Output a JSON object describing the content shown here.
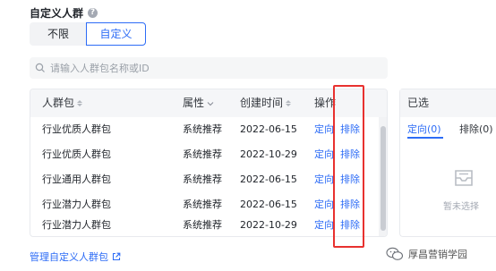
{
  "section": {
    "title": "自定义人群"
  },
  "mode": {
    "options": [
      "不限",
      "自定义"
    ],
    "selected": "自定义"
  },
  "search": {
    "placeholder": "请输入人群包名称或ID"
  },
  "table": {
    "headers": {
      "name": "人群包",
      "attr": "属性",
      "created": "创建时间",
      "actions": "操作"
    },
    "rows": [
      {
        "name": "行业优质人群包",
        "attr": "系统推荐",
        "created": "2022-06-15",
        "action1": "定向",
        "action2": "排除"
      },
      {
        "name": "行业优质人群包",
        "attr": "系统推荐",
        "created": "2022-10-29",
        "action1": "定向",
        "action2": "排除"
      },
      {
        "name": "行业通用人群包",
        "attr": "系统推荐",
        "created": "2022-06-15",
        "action1": "定向",
        "action2": "排除"
      },
      {
        "name": "行业潜力人群包",
        "attr": "系统推荐",
        "created": "2022-06-15",
        "action1": "定向",
        "action2": "排除"
      },
      {
        "name": "行业潜力人群包",
        "attr": "系统推荐",
        "created": "2022-10-29",
        "action1": "定向",
        "action2": "排除"
      }
    ]
  },
  "selected_panel": {
    "title": "已选",
    "tabs": [
      "定向(0)",
      "排除(0)"
    ],
    "empty_text": "暂未选择"
  },
  "footer": {
    "manage_link": "管理自定义人群包"
  },
  "watermark": {
    "text": "厚昌营销学园"
  },
  "colors": {
    "accent": "#2d6cf6",
    "highlight_border": "#e8312f"
  }
}
